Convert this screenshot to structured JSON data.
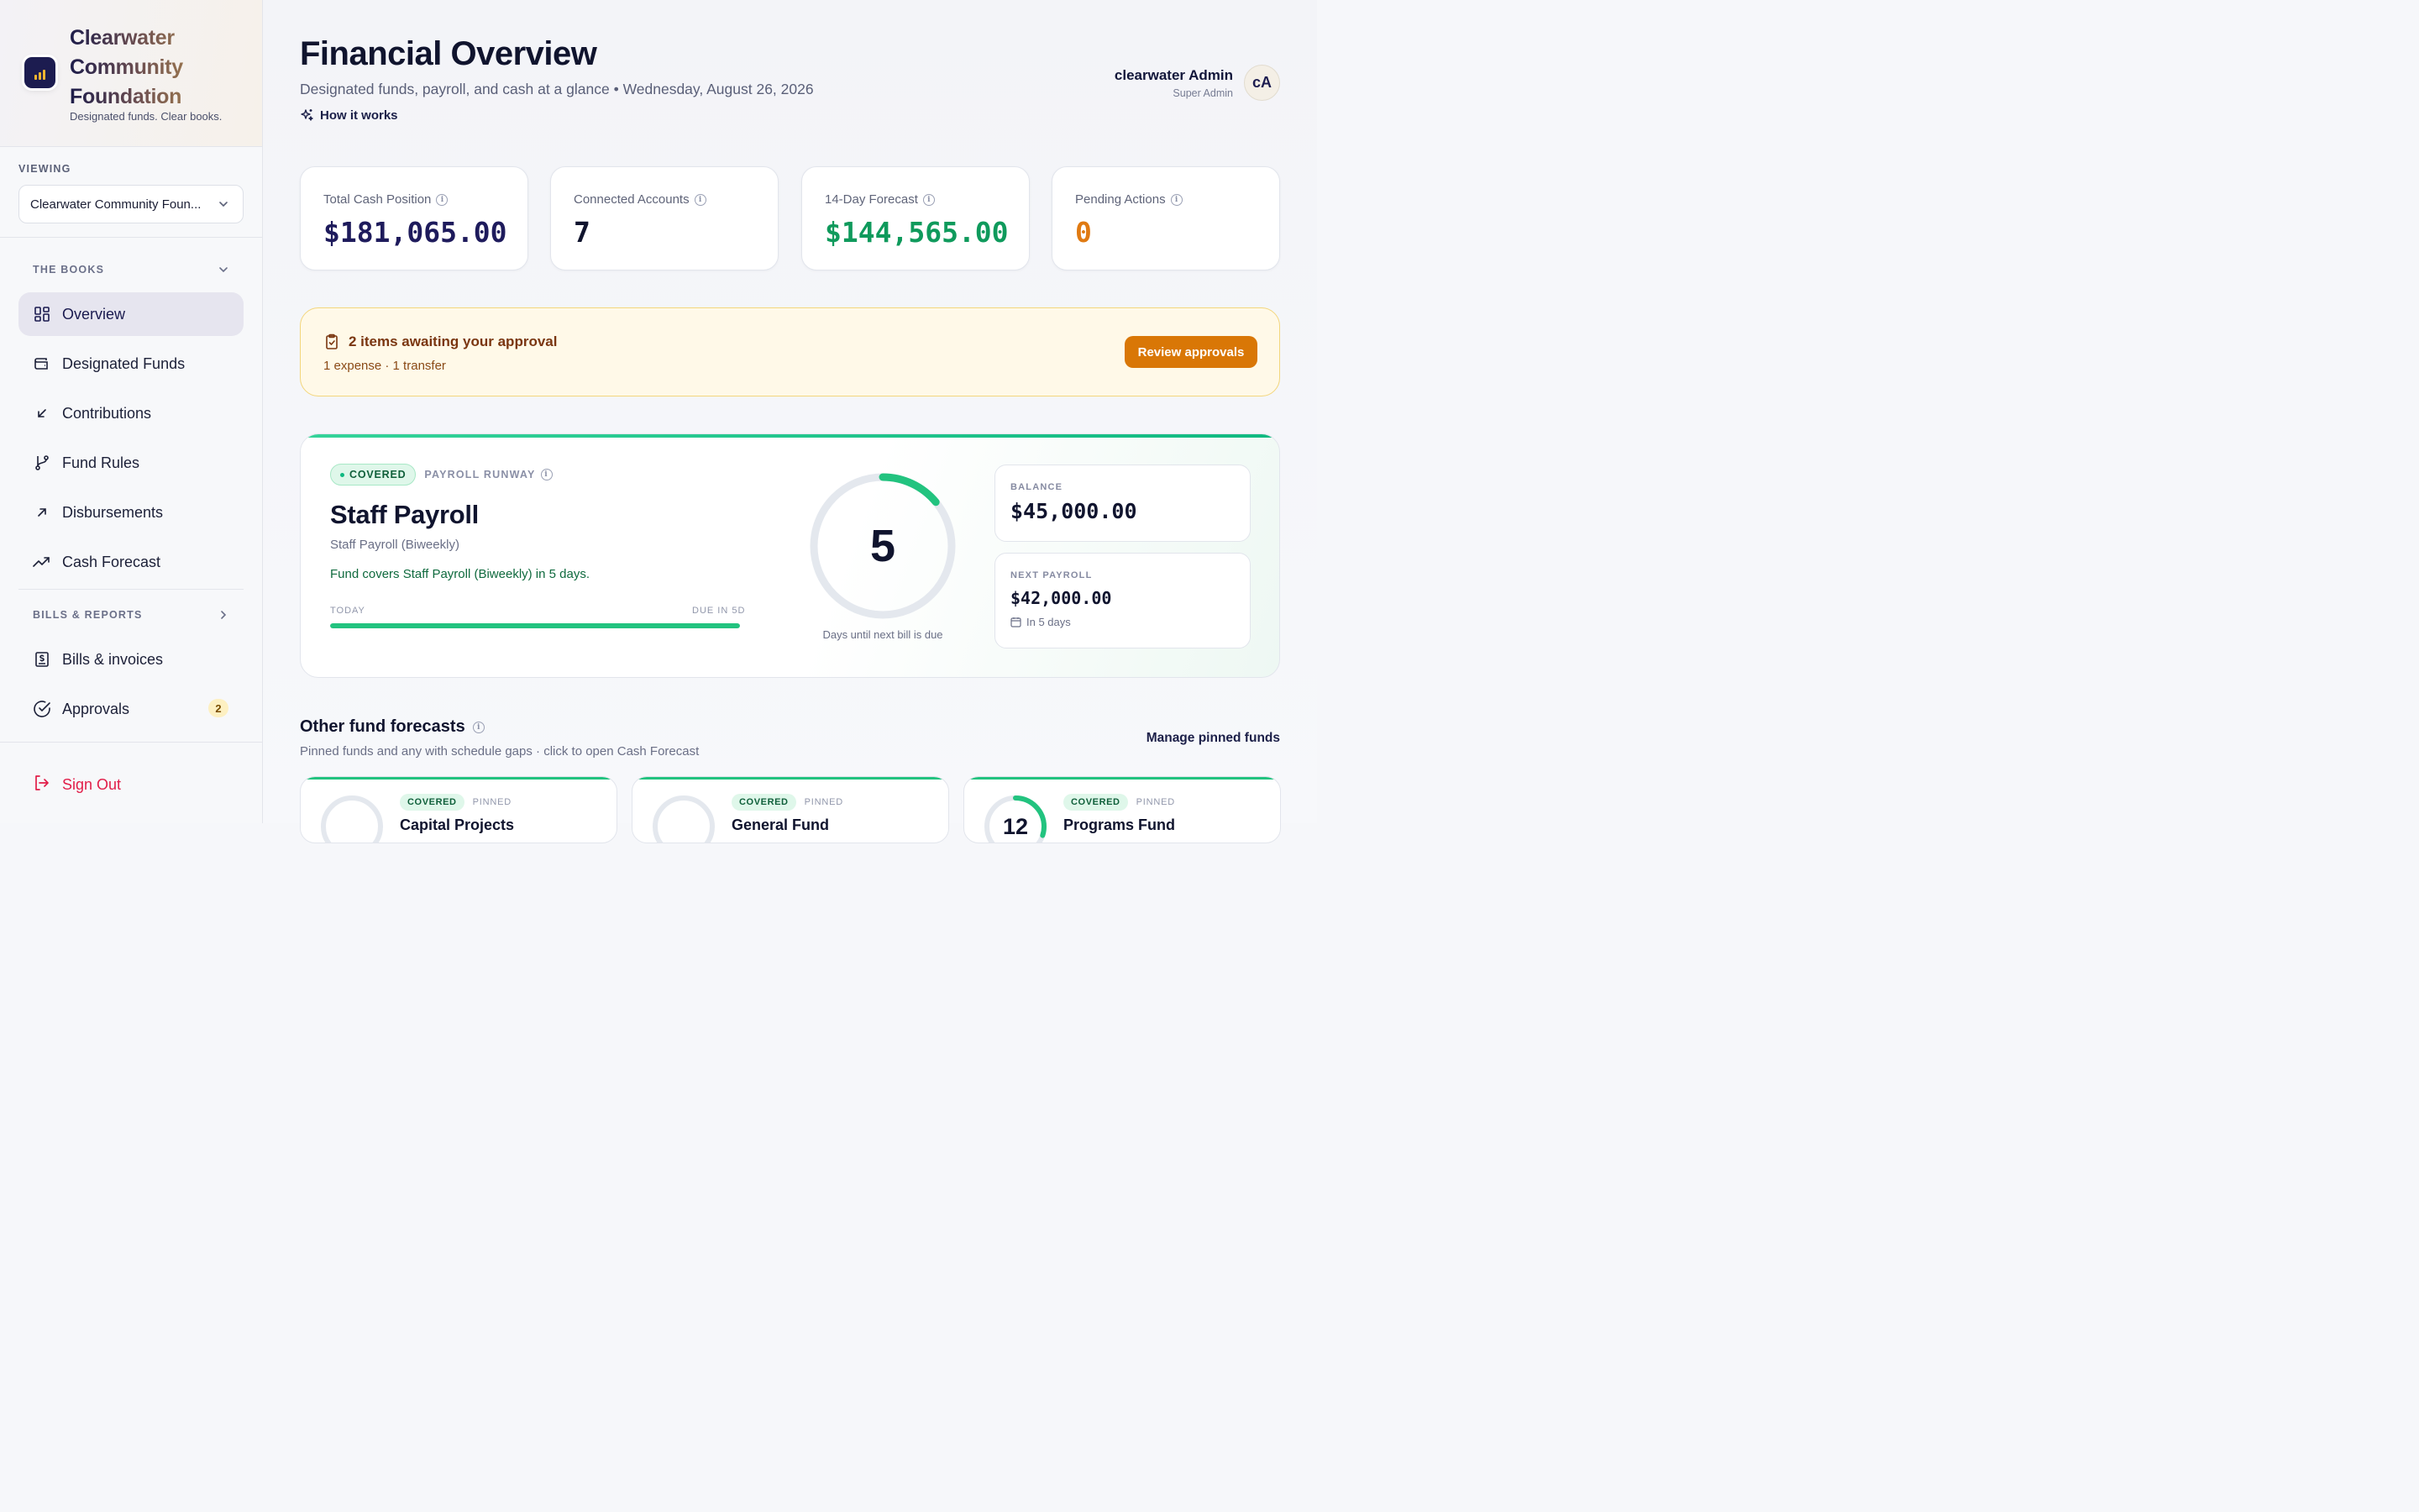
{
  "brand": {
    "name_line1": "Clearwater",
    "name_line2": "Community",
    "name_line3": "Foundation",
    "tagline": "Designated funds. Clear books."
  },
  "viewing": {
    "label": "VIEWING",
    "selected": "Clearwater Community Foun..."
  },
  "nav": {
    "section1": "THE BOOKS",
    "items": [
      {
        "label": "Overview",
        "icon": "grid-icon"
      },
      {
        "label": "Designated Funds",
        "icon": "wallet-icon"
      },
      {
        "label": "Contributions",
        "icon": "arrow-down-left-icon"
      },
      {
        "label": "Fund Rules",
        "icon": "git-branch-icon"
      },
      {
        "label": "Disbursements",
        "icon": "arrow-up-right-icon"
      },
      {
        "label": "Cash Forecast",
        "icon": "trending-up-icon"
      }
    ],
    "section2": "BILLS & REPORTS",
    "items2": [
      {
        "label": "Bills & invoices",
        "icon": "receipt-icon"
      },
      {
        "label": "Approvals",
        "icon": "check-circle-icon",
        "badge": "2"
      }
    ],
    "signout": "Sign Out"
  },
  "header": {
    "title": "Financial Overview",
    "subtitle": "Designated funds, payroll, and cash at a glance • Wednesday, August 26, 2026",
    "how_it_works": "How it works",
    "user_name": "clearwater Admin",
    "user_role": "Super Admin",
    "avatar_initials": "cA"
  },
  "stats": [
    {
      "label": "Total Cash Position",
      "value": "$181,065.00",
      "color": "#1e1b5c"
    },
    {
      "label": "Connected Accounts",
      "value": "7",
      "color": "#10142e"
    },
    {
      "label": "14-Day Forecast",
      "value": "$144,565.00",
      "color": "#0f9a5c"
    },
    {
      "label": "Pending Actions",
      "value": "0",
      "color": "#e07a12"
    }
  ],
  "approval": {
    "title": "2 items awaiting your approval",
    "subtitle": "1 expense · 1 transfer",
    "button": "Review approvals"
  },
  "payroll": {
    "status": "COVERED",
    "section_label": "PAYROLL RUNWAY",
    "title": "Staff Payroll",
    "subtitle": "Staff Payroll (Biweekly)",
    "note": "Fund covers Staff Payroll (Biweekly) in 5 days.",
    "today_label": "TODAY",
    "due_label": "DUE IN 5D",
    "progress_fraction": 1.0,
    "days": "5",
    "ring_fraction": 0.14,
    "ring_caption": "Days until next bill is due",
    "balance_label": "BALANCE",
    "balance_value": "$45,000.00",
    "next_label": "NEXT PAYROLL",
    "next_value": "$42,000.00",
    "next_when": "In 5 days"
  },
  "other": {
    "title": "Other fund forecasts",
    "subtitle": "Pinned funds and any with schedule gaps · click to open Cash Forecast",
    "manage": "Manage pinned funds",
    "funds": [
      {
        "status": "COVERED",
        "pinned": "PINNED",
        "name": "Capital Projects",
        "days": "",
        "ring_fraction": 0
      },
      {
        "status": "COVERED",
        "pinned": "PINNED",
        "name": "General Fund",
        "days": "",
        "ring_fraction": 0
      },
      {
        "status": "COVERED",
        "pinned": "PINNED",
        "name": "Programs Fund",
        "days": "12",
        "ring_fraction": 0.3
      }
    ]
  },
  "colors": {
    "accent": "#1c1c50",
    "success": "#22c37f",
    "warning": "#d97706",
    "danger": "#e11d48"
  }
}
